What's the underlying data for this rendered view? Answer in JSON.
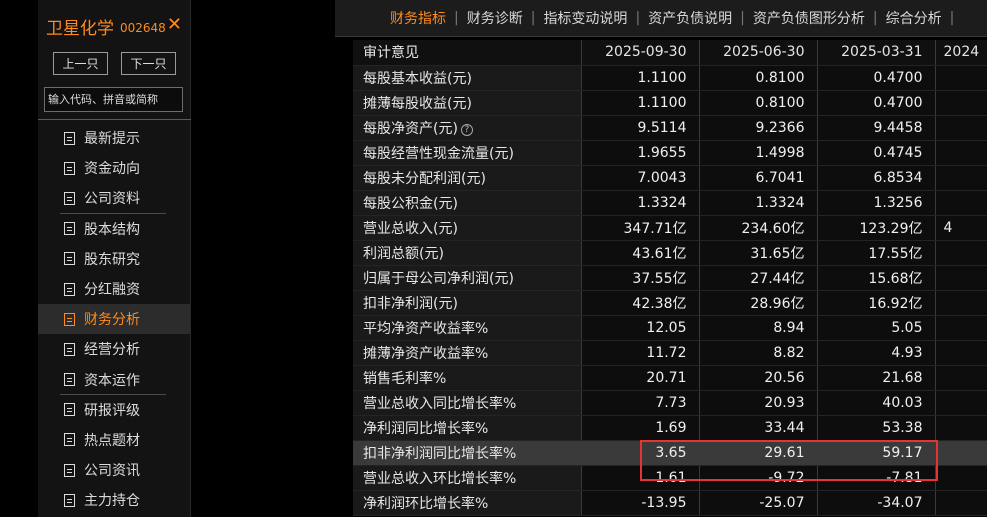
{
  "sidebar": {
    "stock_name": "卫星化学",
    "stock_code": "002648",
    "close_symbol": "✕",
    "prev_label": "上一只",
    "next_label": "下一只",
    "search_placeholder": "输入代码、拼音或简称",
    "items": [
      {
        "label": "最新提示"
      },
      {
        "label": "资金动向"
      },
      {
        "label": "公司资料"
      },
      {
        "label": "股本结构"
      },
      {
        "label": "股东研究"
      },
      {
        "label": "分红融资"
      },
      {
        "label": "财务分析"
      },
      {
        "label": "经营分析"
      },
      {
        "label": "资本运作"
      },
      {
        "label": "研报评级"
      },
      {
        "label": "热点题材"
      },
      {
        "label": "公司资讯"
      },
      {
        "label": "主力持仓"
      }
    ],
    "active_item": "财务分析"
  },
  "tabs": [
    {
      "label": "财务指标"
    },
    {
      "label": "财务诊断"
    },
    {
      "label": "指标变动说明"
    },
    {
      "label": "资产负债说明"
    },
    {
      "label": "资产负债图形分析"
    },
    {
      "label": "综合分析"
    }
  ],
  "active_tab": "财务指标",
  "table": {
    "header_label": "审计意见",
    "columns": [
      "2025-09-30",
      "2025-06-30",
      "2025-03-31",
      "2024"
    ],
    "rows": [
      {
        "label": "每股基本收益(元)",
        "values": [
          "1.1100",
          "0.8100",
          "0.4700",
          ""
        ]
      },
      {
        "label": "摊薄每股收益(元)",
        "values": [
          "1.1100",
          "0.8100",
          "0.4700",
          ""
        ]
      },
      {
        "label": "每股净资产(元)",
        "values": [
          "9.5114",
          "9.2366",
          "9.4458",
          ""
        ]
      },
      {
        "label": "每股经营性现金流量(元)",
        "values": [
          "1.9655",
          "1.4998",
          "0.4745",
          ""
        ]
      },
      {
        "label": "每股未分配利润(元)",
        "values": [
          "7.0043",
          "6.7041",
          "6.8534",
          ""
        ]
      },
      {
        "label": "每股公积金(元)",
        "values": [
          "1.3324",
          "1.3324",
          "1.3256",
          ""
        ]
      },
      {
        "label": "营业总收入(元)",
        "values": [
          "347.71亿",
          "234.60亿",
          "123.29亿",
          "4"
        ]
      },
      {
        "label": "利润总额(元)",
        "values": [
          "43.61亿",
          "31.65亿",
          "17.55亿",
          ""
        ]
      },
      {
        "label": "归属于母公司净利润(元)",
        "values": [
          "37.55亿",
          "27.44亿",
          "15.68亿",
          ""
        ]
      },
      {
        "label": "扣非净利润(元)",
        "values": [
          "42.38亿",
          "28.96亿",
          "16.92亿",
          ""
        ]
      },
      {
        "label": "平均净资产收益率%",
        "values": [
          "12.05",
          "8.94",
          "5.05",
          ""
        ]
      },
      {
        "label": "摊薄净资产收益率%",
        "values": [
          "11.72",
          "8.82",
          "4.93",
          ""
        ]
      },
      {
        "label": "销售毛利率%",
        "values": [
          "20.71",
          "20.56",
          "21.68",
          ""
        ]
      },
      {
        "label": "营业总收入同比增长率%",
        "values": [
          "7.73",
          "20.93",
          "40.03",
          ""
        ]
      },
      {
        "label": "净利润同比增长率%",
        "values": [
          "1.69",
          "33.44",
          "53.38",
          ""
        ]
      },
      {
        "label": "扣非净利润同比增长率%",
        "values": [
          "3.65",
          "29.61",
          "59.17",
          ""
        ]
      },
      {
        "label": "营业总收入环比增长率%",
        "values": [
          "1.61",
          "-9.72",
          "-7.81",
          ""
        ]
      },
      {
        "label": "净利润环比增长率%",
        "values": [
          "-13.95",
          "-25.07",
          "-34.07",
          ""
        ]
      }
    ],
    "highlighted_row": "扣非净利润同比增长率%",
    "help_icon_symbol": "?"
  },
  "colors": {
    "accent": "#ff8a1e",
    "highlight_border": "#e63333"
  }
}
